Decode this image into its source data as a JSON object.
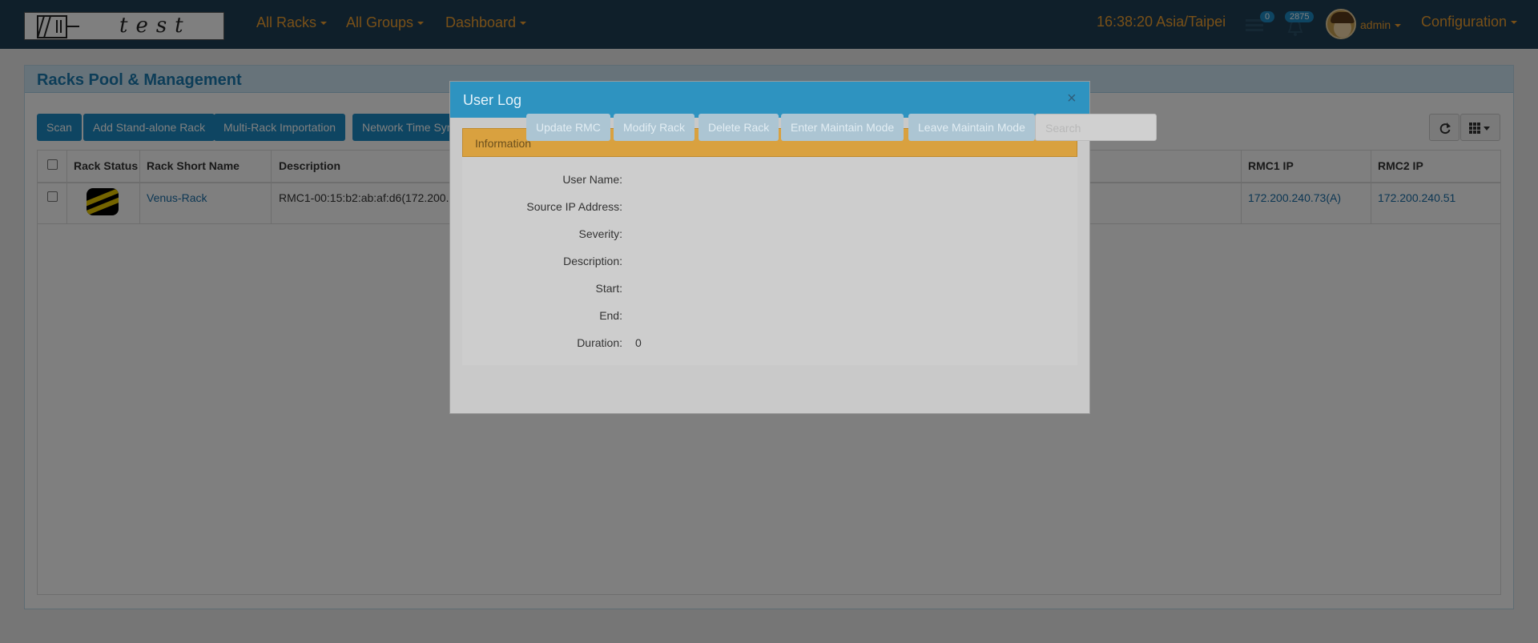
{
  "navbar": {
    "logo_text": "test",
    "menu": [
      "All Racks",
      "All Groups",
      "Dashboard"
    ],
    "clock": "16:38:20 Asia/Taipei",
    "message_count": "0",
    "notification_count": "2875",
    "user": "admin",
    "config": "Configuration"
  },
  "panel": {
    "title": "Racks Pool & Management"
  },
  "toolbar": {
    "buttons": [
      "Scan",
      "Add Stand-alone Rack",
      "Multi-Rack Importation",
      "Network Time Synchronization",
      "Update RMC",
      "Modify Rack",
      "Delete Rack",
      "Enter Maintain Mode",
      "Leave Maintain Mode"
    ],
    "search_placeholder": "Search"
  },
  "table": {
    "columns": [
      "Rack Status",
      "Rack Short Name",
      "Description",
      "RMC1 IP",
      "RMC2 IP"
    ],
    "rows": [
      {
        "name": "Venus-Rack",
        "description": "RMC1-00:15:b2:ab:af:d6(172.200.240....",
        "rmc1_ip": "172.200.240.73(A)",
        "rmc2_ip": "172.200.240.51"
      }
    ]
  },
  "modal": {
    "title": "User Log",
    "close": "×",
    "section": "Information",
    "fields": [
      {
        "label": "User Name:",
        "value": ""
      },
      {
        "label": "Source IP Address:",
        "value": ""
      },
      {
        "label": "Severity:",
        "value": ""
      },
      {
        "label": "Description:",
        "value": ""
      },
      {
        "label": "Start:",
        "value": ""
      },
      {
        "label": "End:",
        "value": ""
      },
      {
        "label": "Duration:",
        "value": "0"
      }
    ]
  },
  "colors": {
    "navbar": "#1f3e54",
    "accent": "#f0a030",
    "primary": "#1c8bc4",
    "warning": "#d9a13f"
  }
}
